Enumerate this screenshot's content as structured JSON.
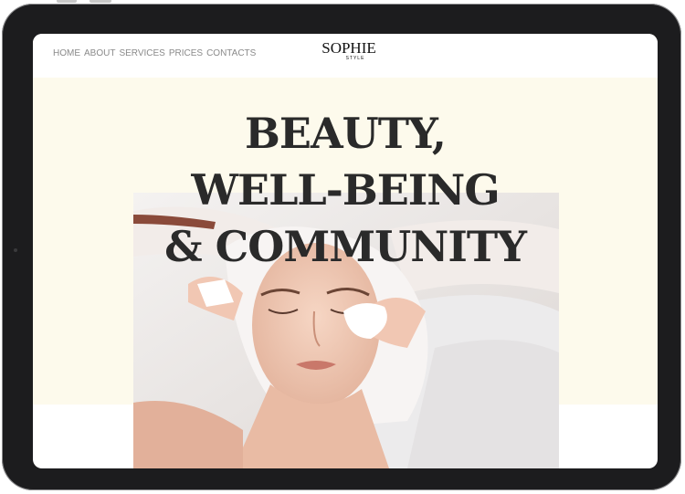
{
  "nav": {
    "items": [
      "HOME",
      "ABOUT",
      "SERVICES",
      "PRICES",
      "CONTACTS"
    ]
  },
  "logo": {
    "main": "SOPHIE",
    "sub": "STYLE"
  },
  "hero": {
    "lines": [
      "BEAUTY,",
      "WELL-BEING",
      "& COMMUNITY"
    ]
  },
  "colors": {
    "device_bezel": "#1c1c1e",
    "hero_background": "#fdfaec",
    "headline": "#2a2a2a",
    "nav_text": "#8a8a8a"
  }
}
